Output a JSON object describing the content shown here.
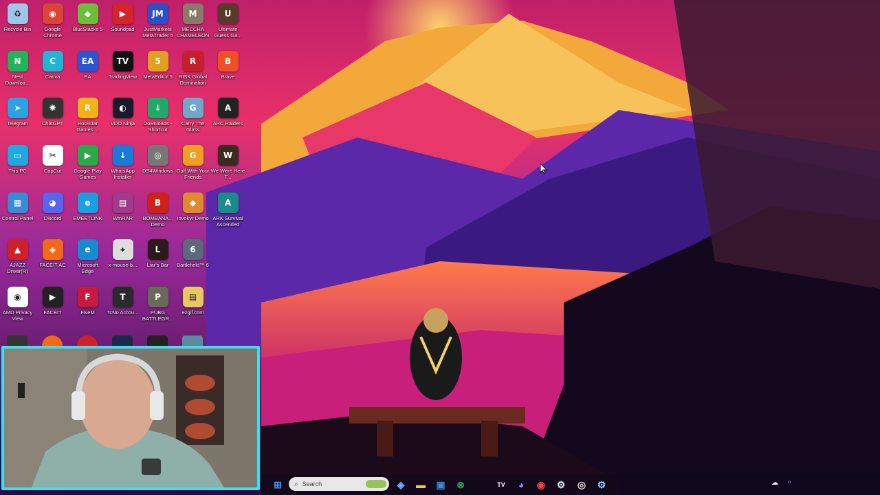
{
  "desktop_icons": [
    {
      "label": "Recycle Bin",
      "icon": "recycle-bin-icon",
      "color": "#9fc6e8",
      "glyph": "♻"
    },
    {
      "label": "Google Chrome",
      "icon": "chrome-icon",
      "color": "#db4437",
      "glyph": "◉"
    },
    {
      "label": "BlueStacks 5",
      "icon": "bluestacks-icon",
      "color": "#6cbf3a",
      "glyph": "◆"
    },
    {
      "label": "Soundpad",
      "icon": "soundpad-icon",
      "color": "#d6252a",
      "glyph": "▶"
    },
    {
      "label": "JustMarkets MetaTrader 5",
      "icon": "justmarkets-icon",
      "color": "#2a4fc9",
      "glyph": "JM"
    },
    {
      "label": "MECCHA CHAMELEON",
      "icon": "meccha-icon",
      "color": "#8a7a6a",
      "glyph": "M"
    },
    {
      "label": "Ultimate Guess Ga...",
      "icon": "guess-game-icon",
      "color": "#5a3a2a",
      "glyph": "U"
    },
    {
      "label": "Nest Downloa...",
      "icon": "nest-icon",
      "color": "#1fb55b",
      "glyph": "N"
    },
    {
      "label": "Canva",
      "icon": "canva-icon",
      "color": "#1fb6d6",
      "glyph": "C"
    },
    {
      "label": "EA",
      "icon": "ea-icon",
      "color": "#2a56d6",
      "glyph": "EA"
    },
    {
      "label": "TradingView",
      "icon": "tradingview-icon",
      "color": "#111111",
      "glyph": "TV"
    },
    {
      "label": "MetaEditor 5",
      "icon": "metaeditor-icon",
      "color": "#e0a020",
      "glyph": "5"
    },
    {
      "label": "RISK Global Domination",
      "icon": "risk-icon",
      "color": "#c8202a",
      "glyph": "R"
    },
    {
      "label": "Brave",
      "icon": "brave-icon",
      "color": "#f04f24",
      "glyph": "B"
    },
    {
      "label": "Telegram",
      "icon": "telegram-icon",
      "color": "#2aa3e0",
      "glyph": "➤"
    },
    {
      "label": "ChatGPT",
      "icon": "chatgpt-icon",
      "color": "#333333",
      "glyph": "✺"
    },
    {
      "label": "Rockstar Games ...",
      "icon": "rockstar-icon",
      "color": "#f2b21b",
      "glyph": "R"
    },
    {
      "label": "VDO.Ninja",
      "icon": "vdo-ninja-icon",
      "color": "#1a1a2a",
      "glyph": "◐"
    },
    {
      "label": "Downloads - Shortcut",
      "icon": "downloads-folder-icon",
      "color": "#1ea86a",
      "glyph": "↓"
    },
    {
      "label": "Carry The Glass",
      "icon": "carry-glass-icon",
      "color": "#6fa8c8",
      "glyph": "G"
    },
    {
      "label": "ARC Raiders",
      "icon": "arc-raiders-icon",
      "color": "#222222",
      "glyph": "A"
    },
    {
      "label": "This PC",
      "icon": "this-pc-icon",
      "color": "#22a8e0",
      "glyph": "▭"
    },
    {
      "label": "CapCut",
      "icon": "capcut-icon",
      "color": "#ffffff",
      "glyph": "✂"
    },
    {
      "label": "Google Play Games",
      "icon": "play-games-icon",
      "color": "#2aa84a",
      "glyph": "▶"
    },
    {
      "label": "WhatsApp Installer",
      "icon": "whatsapp-installer-icon",
      "color": "#1a7ad8",
      "glyph": "↓"
    },
    {
      "label": "DS4Windows",
      "icon": "ds4windows-icon",
      "color": "#777777",
      "glyph": "◎"
    },
    {
      "label": "Golf With Your Friends",
      "icon": "golf-icon",
      "color": "#f0a020",
      "glyph": "G"
    },
    {
      "label": "We Were Here T...",
      "icon": "we-were-here-icon",
      "color": "#3a2a20",
      "glyph": "W"
    },
    {
      "label": "Control Panel",
      "icon": "control-panel-icon",
      "color": "#3a8ad8",
      "glyph": "▦"
    },
    {
      "label": "Discord",
      "icon": "discord-icon",
      "color": "#5865f2",
      "glyph": "◕"
    },
    {
      "label": "EMEETLINK",
      "icon": "emeetlink-icon",
      "color": "#1aa0e0",
      "glyph": "e"
    },
    {
      "label": "WinRAR",
      "icon": "winrar-icon",
      "color": "#a03a8a",
      "glyph": "▤"
    },
    {
      "label": "BOMBANA... Demo",
      "icon": "bombana-icon",
      "color": "#d0201a",
      "glyph": "B"
    },
    {
      "label": "Invokyr Demo",
      "icon": "invokyr-icon",
      "color": "#e08a30",
      "glyph": "◆"
    },
    {
      "label": "ARK Survival Ascended",
      "icon": "ark-icon",
      "color": "#1a8a8a",
      "glyph": "A"
    },
    {
      "label": "AJAZZ Driver(R)",
      "icon": "ajazz-icon",
      "color": "#d0202a",
      "glyph": "▲"
    },
    {
      "label": "FACEIT AC",
      "icon": "faceit-ac-icon",
      "color": "#f06a1a",
      "glyph": "◈"
    },
    {
      "label": "Microsoft Edge",
      "icon": "edge-icon",
      "color": "#1a8ad0",
      "glyph": "e"
    },
    {
      "label": "x-mouse-b...",
      "icon": "x-mouse-icon",
      "color": "#dddddd",
      "glyph": "⌖"
    },
    {
      "label": "Liar's Bar",
      "icon": "liars-bar-icon",
      "color": "#2a1a1a",
      "glyph": "L"
    },
    {
      "label": "Battlefield™ 6",
      "icon": "battlefield-icon",
      "color": "#5a6a7a",
      "glyph": "6"
    },
    {
      "label": "",
      "icon": "empty-slot",
      "color": "transparent",
      "glyph": ""
    },
    {
      "label": "AMD Privacy View",
      "icon": "amd-privacy-icon",
      "color": "#ffffff",
      "glyph": "◉"
    },
    {
      "label": "FACEIT",
      "icon": "faceit-icon",
      "color": "#222222",
      "glyph": "▶"
    },
    {
      "label": "FiveM",
      "icon": "fivem-icon",
      "color": "#c81a3a",
      "glyph": "F"
    },
    {
      "label": "TcNo Accou...",
      "icon": "tcno-icon",
      "color": "#2a2a2a",
      "glyph": "T"
    },
    {
      "label": "PUBG BATTLEGR...",
      "icon": "pubg-icon",
      "color": "#6a6a5a",
      "glyph": "P"
    },
    {
      "label": "ezgif.com",
      "icon": "ezgif-icon",
      "color": "#e8c860",
      "glyph": "▤"
    }
  ],
  "taskbar": {
    "search_placeholder": "Search",
    "items": [
      {
        "name": "start-button-icon",
        "glyph": "⊞",
        "color": "#3aa0ff"
      },
      {
        "name": "copilot-icon",
        "glyph": "◈",
        "color": "#6ab0ff"
      },
      {
        "name": "file-explorer-icon",
        "glyph": "▬",
        "color": "#f2c84b"
      },
      {
        "name": "store-icon",
        "glyph": "▣",
        "color": "#3a8ad8"
      },
      {
        "name": "xbox-icon",
        "glyph": "⊗",
        "color": "#2aa84a"
      },
      {
        "name": "tradingview-taskbar-icon",
        "glyph": "TV",
        "color": "#ffffff"
      },
      {
        "name": "discord-taskbar-icon",
        "glyph": "◕",
        "color": "#8a90ff"
      },
      {
        "name": "chrome-taskbar-icon",
        "glyph": "◉",
        "color": "#f04a3a"
      },
      {
        "name": "steam-taskbar-icon",
        "glyph": "⚙",
        "color": "#dfe6f0"
      },
      {
        "name": "obs-taskbar-icon",
        "glyph": "◎",
        "color": "#dddddd"
      },
      {
        "name": "steam2-taskbar-icon",
        "glyph": "⚙",
        "color": "#9ad0ff"
      }
    ]
  },
  "colors": {
    "webcam_border": "#38e0f0",
    "sky_top": "#b5206e",
    "sky_mid": "#ff6a2a"
  }
}
